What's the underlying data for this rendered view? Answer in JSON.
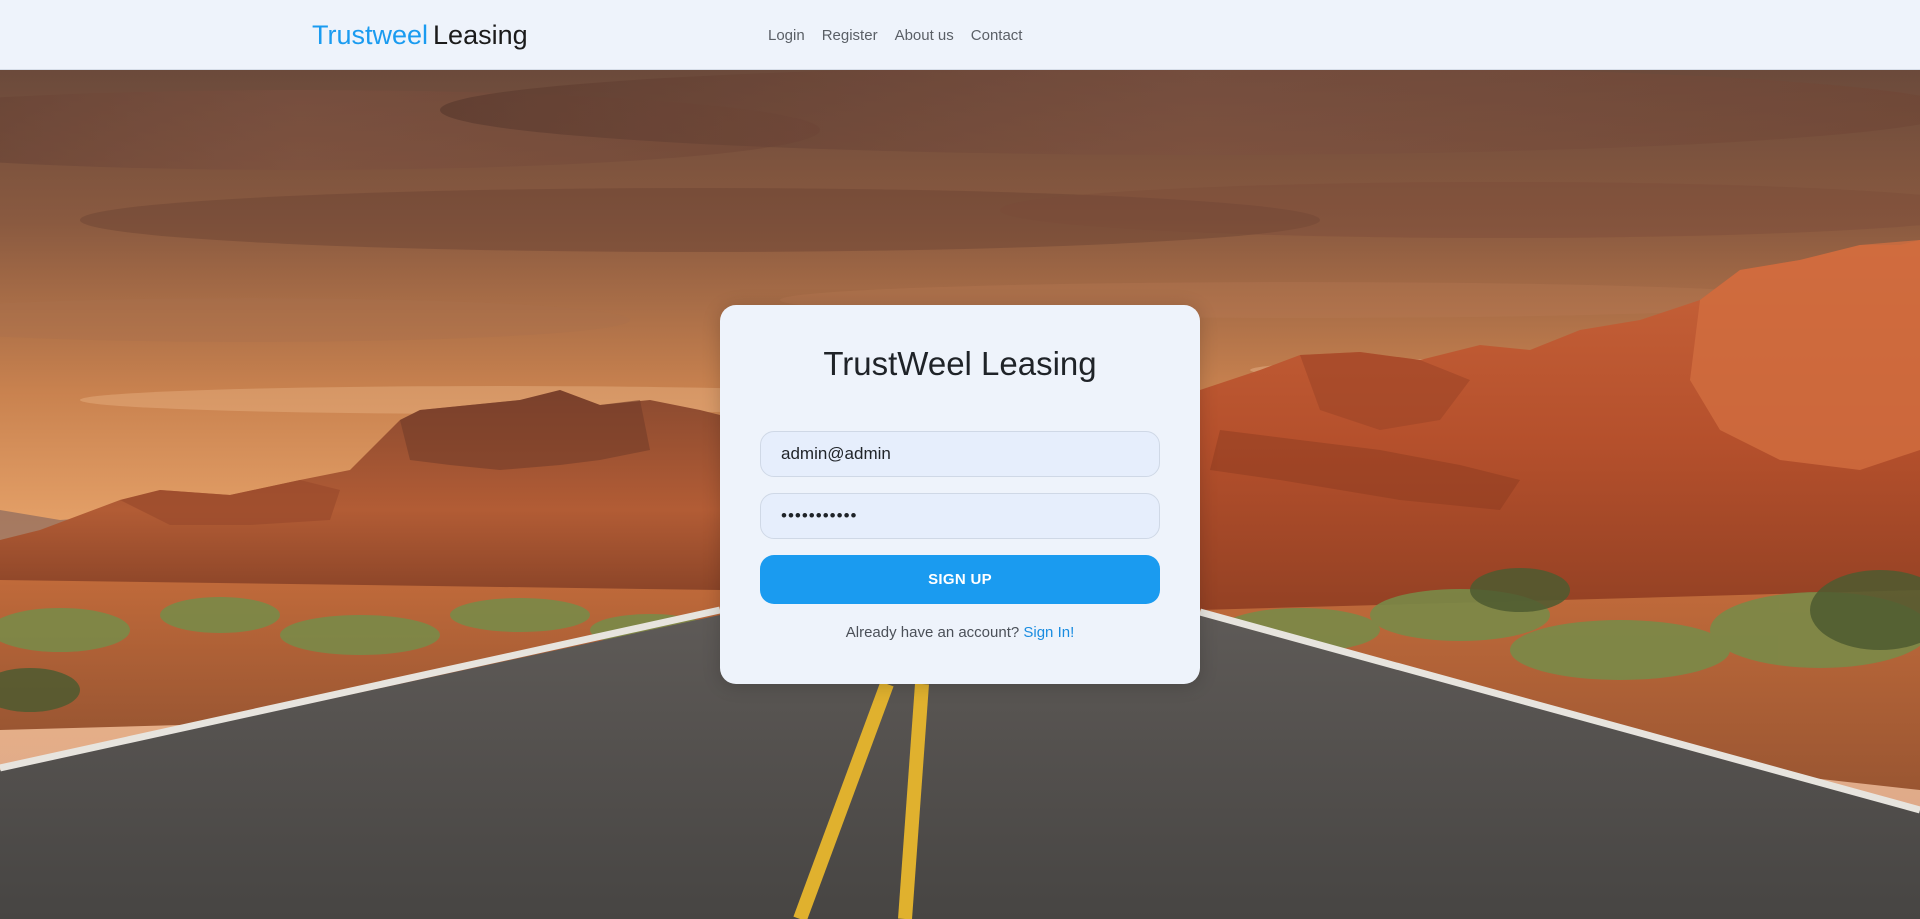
{
  "navbar": {
    "brand_part1": "Trustweel",
    "brand_part2": "Leasing",
    "links": [
      {
        "label": "Login"
      },
      {
        "label": "Register"
      },
      {
        "label": "About us"
      },
      {
        "label": "Contact"
      }
    ]
  },
  "card": {
    "title": "TrustWeel Leasing",
    "email_value": "admin@admin",
    "password_value": "•••••••••••",
    "submit_label": "SIGN UP",
    "signin_prompt": "Already have an account?",
    "signin_link": "Sign In!"
  },
  "colors": {
    "accent": "#1a9bf0",
    "navbar_bg": "#eef3fb",
    "card_bg": "#eef3fb"
  }
}
